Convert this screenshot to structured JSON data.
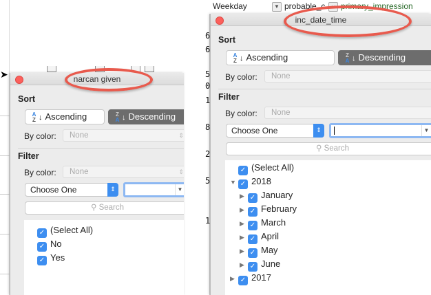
{
  "spreadsheet": {
    "column_headers": [
      "Weekday",
      "probable_c",
      "primary_impression"
    ],
    "row_digits": [
      "6",
      "6",
      "5",
      "0",
      "1",
      "8",
      "2",
      "5",
      "1"
    ]
  },
  "left_panel": {
    "title": "narcan given",
    "sort_label": "Sort",
    "ascending": "Ascending",
    "descending": "Descending",
    "by_color_label": "By color:",
    "sort_color": "None",
    "filter_label": "Filter",
    "filter_color": "None",
    "choose": "Choose One",
    "search_placeholder": "Search",
    "items": [
      "(Select All)",
      "No",
      "Yes"
    ]
  },
  "right_panel": {
    "title": "inc_date_time",
    "sort_label": "Sort",
    "ascending": "Ascending",
    "descending": "Descending",
    "by_color_label": "By color:",
    "sort_color": "None",
    "filter_label": "Filter",
    "filter_color": "None",
    "choose": "Choose One",
    "search_placeholder": "Search",
    "items": {
      "select_all": "(Select All)",
      "year_2018": "2018",
      "months": [
        "January",
        "February",
        "March",
        "April",
        "May",
        "June"
      ],
      "year_2017": "2017"
    }
  },
  "colors": {
    "accent": "#3d8ef0",
    "highlight": "#e85a4d",
    "selected_button": "#6d6d6d"
  }
}
